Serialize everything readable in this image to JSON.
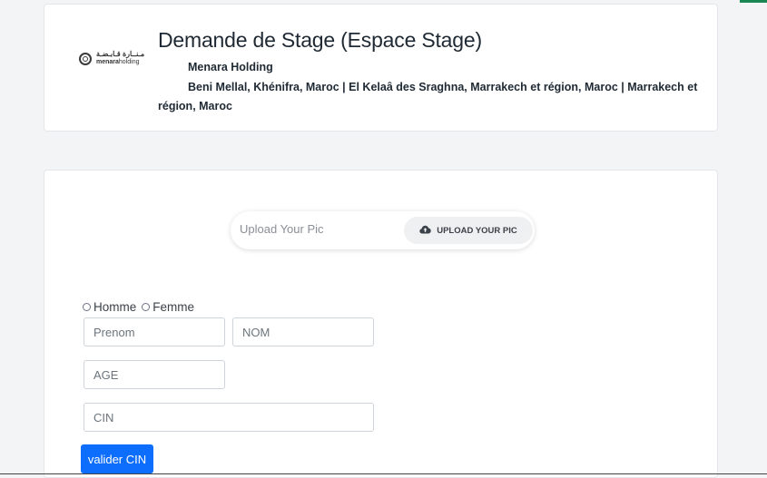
{
  "header": {
    "logo": {
      "arabic_text": "مـنــارة قـابـضـة",
      "name_bold": "menara",
      "name_rest": "holding"
    },
    "title": "Demande de Stage (Espace Stage)",
    "company": "Menara Holding",
    "locations": "Beni Mellal, Khénifra, Maroc | El Kelaâ des Sraghna, Marrakech et région, Maroc | Marrakech et région, Maroc"
  },
  "upload": {
    "placeholder_text": "Upload Your Pic",
    "button_label": "UPLOAD YOUR PIC",
    "button_icon": "cloud-upload-icon"
  },
  "gender": {
    "options": [
      "Homme",
      "Femme"
    ]
  },
  "form": {
    "prenom_placeholder": "Prenom",
    "nom_placeholder": "NOM",
    "age_placeholder": "AGE",
    "cin_placeholder": "CIN",
    "valider_label": "valider CIN"
  },
  "colors": {
    "primary": "#0d6efd",
    "accent": "#198754",
    "background": "#f3f4f6"
  }
}
